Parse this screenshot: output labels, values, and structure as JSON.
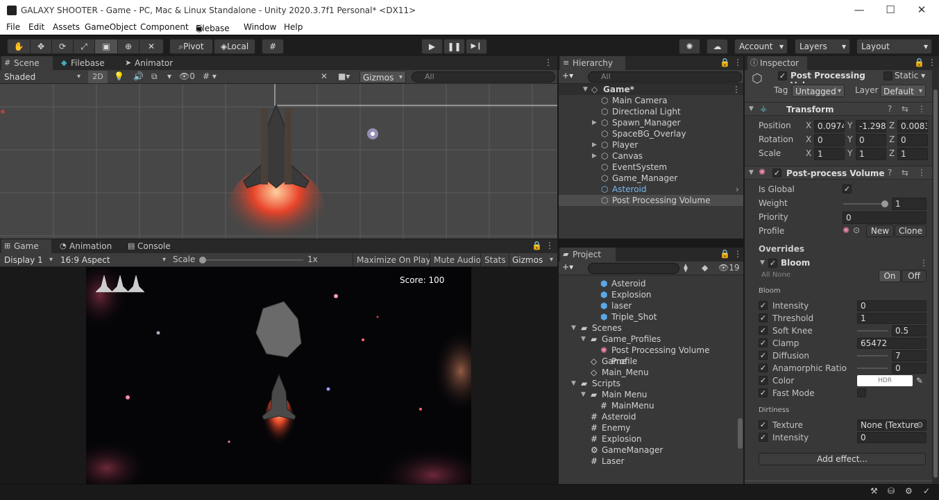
{
  "window": {
    "title": "GALAXY SHOOTER - Game - PC, Mac & Linux Standalone - Unity 2020.3.7f1 Personal* <DX11>",
    "minimize": "—",
    "maximize": "☐",
    "close": "✕"
  },
  "menu": [
    "File",
    "Edit",
    "Assets",
    "GameObject",
    "Component",
    "Filebase",
    "Window",
    "Help"
  ],
  "toolbar": {
    "pivot": "Pivot",
    "local": "Local",
    "play": "▶",
    "pause": "❚❚",
    "step": "▶❙",
    "account": "Account",
    "layers": "Layers",
    "layout": "Layout"
  },
  "scene": {
    "tabs": [
      "Scene",
      "Filebase",
      "Animator"
    ],
    "shading": "Shaded",
    "mode_2d": "2D",
    "hidden_count": "0",
    "gizmos": "Gizmos",
    "search_placeholder": "All"
  },
  "game": {
    "tabs": [
      "Game",
      "Animation",
      "Console"
    ],
    "display": "Display 1",
    "aspect": "16:9 Aspect",
    "scale_label": "Scale",
    "scale_value": "1x",
    "maximize": "Maximize On Play",
    "mute": "Mute Audio",
    "stats": "Stats",
    "gizmos": "Gizmos",
    "score": "Score: 100"
  },
  "hierarchy": {
    "tab": "Hierarchy",
    "search_placeholder": "All",
    "scene": "Game*",
    "items": [
      {
        "label": "Main Camera",
        "arrow": false,
        "selected": false
      },
      {
        "label": "Directional Light",
        "arrow": false,
        "selected": false
      },
      {
        "label": "Spawn_Manager",
        "arrow": true,
        "selected": false
      },
      {
        "label": "SpaceBG_Overlay",
        "arrow": false,
        "selected": false
      },
      {
        "label": "Player",
        "arrow": true,
        "selected": false
      },
      {
        "label": "Canvas",
        "arrow": true,
        "selected": false
      },
      {
        "label": "EventSystem",
        "arrow": false,
        "selected": false
      },
      {
        "label": "Game_Manager",
        "arrow": false,
        "selected": false
      },
      {
        "label": "Asteroid",
        "arrow": false,
        "selected": false,
        "prefab": true
      },
      {
        "label": "Post Processing Volume",
        "arrow": false,
        "selected": true
      }
    ]
  },
  "project": {
    "tab": "Project",
    "hidden_count": "19",
    "items": [
      {
        "label": "Asteroid",
        "icon": "prefab",
        "indent": 3
      },
      {
        "label": "Explosion",
        "icon": "prefab",
        "indent": 3
      },
      {
        "label": "laser",
        "icon": "prefab",
        "indent": 3
      },
      {
        "label": "Triple_Shot",
        "icon": "prefab",
        "indent": 3
      },
      {
        "label": "Scenes",
        "icon": "folder",
        "indent": 1,
        "open": true
      },
      {
        "label": "Game_Profiles",
        "icon": "folder",
        "indent": 2,
        "open": true
      },
      {
        "label": "Post Processing Volume Profile",
        "icon": "profile",
        "indent": 3
      },
      {
        "label": "Game",
        "icon": "unity",
        "indent": 2
      },
      {
        "label": "Main_Menu",
        "icon": "unity",
        "indent": 2
      },
      {
        "label": "Scripts",
        "icon": "folder",
        "indent": 1,
        "open": true
      },
      {
        "label": "Main Menu",
        "icon": "folder",
        "indent": 2,
        "open": true
      },
      {
        "label": "MainMenu",
        "icon": "script",
        "indent": 3
      },
      {
        "label": "Asteroid",
        "icon": "script",
        "indent": 2
      },
      {
        "label": "Enemy",
        "icon": "script",
        "indent": 2
      },
      {
        "label": "Explosion",
        "icon": "script",
        "indent": 2
      },
      {
        "label": "GameManager",
        "icon": "gear",
        "indent": 2
      },
      {
        "label": "Laser",
        "icon": "script",
        "indent": 2
      }
    ]
  },
  "inspector": {
    "tab": "Inspector",
    "object_name": "Post Processing Volu",
    "static": "Static",
    "tag_label": "Tag",
    "tag": "Untagged",
    "layer_label": "Layer",
    "layer": "Default",
    "transform": {
      "title": "Transform",
      "rows": [
        {
          "label": "Position",
          "x": "0.0974",
          "y": "-1.298",
          "z": "0.0083"
        },
        {
          "label": "Rotation",
          "x": "0",
          "y": "0",
          "z": "0"
        },
        {
          "label": "Scale",
          "x": "1",
          "y": "1",
          "z": "1"
        }
      ]
    },
    "volume": {
      "title": "Post-process Volume",
      "is_global_label": "Is Global",
      "weight_label": "Weight",
      "weight": "1",
      "weight_fraction": 1.0,
      "priority_label": "Priority",
      "priority": "0",
      "profile_label": "Profile",
      "new": "New",
      "clone": "Clone",
      "overrides": "Overrides"
    },
    "bloom": {
      "title": "Bloom",
      "all": "All",
      "none": "None",
      "on": "On",
      "off": "Off",
      "section_bloom": "Bloom",
      "section_dirt": "Dirtiness",
      "rows": [
        {
          "label": "Intensity",
          "value": "0"
        },
        {
          "label": "Threshold",
          "value": "1"
        },
        {
          "label": "Soft Knee",
          "value": "0.5"
        },
        {
          "label": "Clamp",
          "value": "65472"
        },
        {
          "label": "Diffusion",
          "value": "7"
        },
        {
          "label": "Anamorphic Ratio",
          "value": "0"
        },
        {
          "label": "Color",
          "value": "HDR"
        },
        {
          "label": "Fast Mode",
          "value": ""
        }
      ],
      "dirt_rows": [
        {
          "label": "Texture",
          "value": "None (Texture"
        },
        {
          "label": "Intensity",
          "value": "0"
        }
      ]
    },
    "add_effect": "Add effect..."
  },
  "colors": {
    "selection": "#2c5d87",
    "prefab_blue": "#7cb8f0",
    "panel": "#383838",
    "dark": "#282828"
  }
}
